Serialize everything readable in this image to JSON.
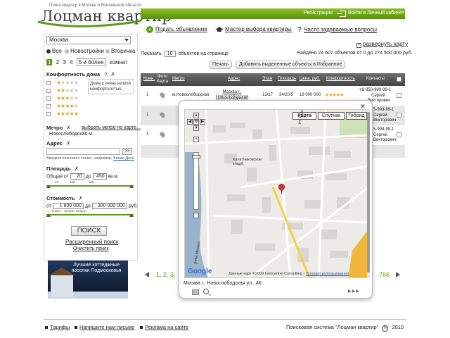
{
  "logo": {
    "tagline": "Поиск квартир в Москве и Московской области",
    "name": "Лоцман квартир"
  },
  "topbar": {
    "register": "Регистрация",
    "login": "Войти в Личный кабинет"
  },
  "actions": {
    "add_ad": "Подать объявление",
    "wizard": "Мастер выбора квартиры",
    "faq": "Часто задаваемые вопросы"
  },
  "filters": {
    "city": "Москва",
    "market": [
      "Все",
      "Новостройки",
      "Вторичка"
    ],
    "rooms": [
      "1",
      "2",
      "3",
      "4",
      "5 и более",
      "комнат"
    ],
    "comfort_title": "Комфортность дома",
    "comfort_q": "?",
    "comfort_clear": "✗",
    "comfort_note": "Дома с очень низкой комфортностью.",
    "comfort_stars": [
      1,
      2,
      3,
      4,
      5
    ],
    "metro_title": "Метро",
    "metro_link": "выбрать метро по карте...",
    "metro_value": "Новослободская м.",
    "address_title": "Адрес",
    "address_go": ">>",
    "address_hint": "Введите ключевое слово, например,",
    "address_hint_example": "Белая Дача",
    "area_title": "Площадь",
    "area_label": "Общая от",
    "area_from": "20",
    "area_to_label": "до",
    "area_to": "450",
    "area_unit": "кв.м",
    "area_ticks": [
      "40",
      "120",
      "225"
    ],
    "price_title": "Стоимость",
    "price_from_label": "от",
    "price_from": "1 800 000",
    "price_to_label": "до",
    "price_to": "300 000 000",
    "price_unit": "руб.",
    "price_ticks": [
      "5 млн.",
      "15 млн.",
      "60 млн."
    ],
    "search_button": "ПОИСК",
    "advanced": "Расширенный поиск",
    "clear": "Очистить поиск"
  },
  "banner": {
    "text": "Лучшие коттеджные поселки Подмосковья"
  },
  "list": {
    "show_label": "Показать",
    "per_page": "10",
    "per_page_suffix": "объектов на странице",
    "found": "Найдено 24 607 объектов от 0 до 274 500 000 руб.",
    "expand_map": "развернуть карту",
    "print": "Печать",
    "add_fav": "Добавить выделенные объекты в Избранное"
  },
  "table": {
    "headers": [
      "Комн.",
      "Фото Карта",
      "Метро",
      "Адрес",
      "Этаж",
      "Площадь",
      "Цена, руб.",
      "Комфортность",
      "Контакты"
    ],
    "rows": [
      {
        "rooms": "1",
        "metro": "м.Новослободская",
        "address": "Москва г., Новослободская ул., 46",
        "floor": "12/17",
        "area": "34/20/5",
        "price": "18 000 000",
        "stars": "★★★★★",
        "phone": "т.8-950-999-99-1",
        "name": "Сергей Викторович"
      },
      {
        "rooms": "1",
        "metro": "",
        "address": "",
        "floor": "",
        "area": "",
        "price": "",
        "stars": "",
        "phone": "5-999-99-1",
        "name": "Сергей Викторович"
      },
      {
        "rooms": "1",
        "metro": "",
        "address": "",
        "floor": "",
        "area": "",
        "price": "",
        "stars": "",
        "phone": "5-999-99-1",
        "name": "Сергей Викторович"
      }
    ]
  },
  "pager": {
    "pages": "1, 2, 3,",
    "last": "766"
  },
  "map": {
    "close": "✕",
    "types": [
      "Карта",
      "Спутник",
      "Гибрид"
    ],
    "labels": {
      "cemetery": "Калитниковское кладб.",
      "street": "ул. Карла Маркса",
      "river": "река Москва"
    },
    "google": "Google",
    "copyright": "Данные карт ©2009 Geocentre Consulting -",
    "terms": "Условия использования",
    "address": "Москва г., Новослободская ул., 46"
  },
  "footer": {
    "tariffs": "Тарифы",
    "write": "Напишите нам письмо",
    "ads": "Реклама на сайте",
    "system": "Поисковая система \"Лоцман квартир\"",
    "copy": "©",
    "year": "2010"
  },
  "colors": {
    "accent": "#5f9a1a",
    "star": "#e7a31a",
    "header_bg": "#4e4e4e"
  }
}
